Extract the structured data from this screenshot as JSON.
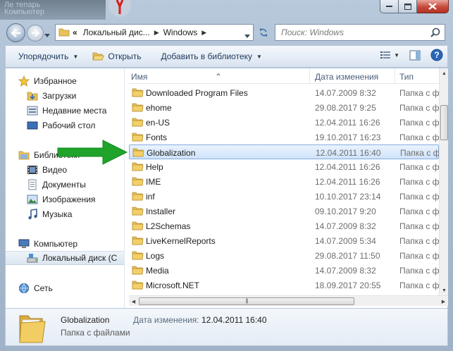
{
  "background": {
    "faint_text": "Ле тепарь\nКомпьютер"
  },
  "window": {
    "caption_buttons": [
      "minimize",
      "maximize",
      "close"
    ]
  },
  "address": {
    "crumbs": [
      "Локальный дис...",
      "Windows"
    ],
    "overflow": "«"
  },
  "search": {
    "placeholder": "Поиск: Windows"
  },
  "toolbar": {
    "organize": "Упорядочить",
    "open": "Открыть",
    "add_library": "Добавить в библиотеку"
  },
  "nav": {
    "favorites": "Избранное",
    "downloads": "Загрузки",
    "recent": "Недавние места",
    "desktop": "Рабочий стол",
    "libraries": "Библиотеки",
    "video": "Видео",
    "documents": "Документы",
    "pictures": "Изображения",
    "music": "Музыка",
    "computer": "Компьютер",
    "local_disk": "Локальный диск (С",
    "network": "Сеть"
  },
  "columns": {
    "name": "Имя",
    "date": "Дата изменения",
    "type": "Тип"
  },
  "files": [
    {
      "name": "Downloaded Program Files",
      "date": "14.07.2009 8:32",
      "type": "Папка с ф"
    },
    {
      "name": "ehome",
      "date": "29.08.2017 9:25",
      "type": "Папка с ф"
    },
    {
      "name": "en-US",
      "date": "12.04.2011 16:26",
      "type": "Папка с ф"
    },
    {
      "name": "Fonts",
      "date": "19.10.2017 16:23",
      "type": "Папка с ф"
    },
    {
      "name": "Globalization",
      "date": "12.04.2011 16:40",
      "type": "Папка с ф"
    },
    {
      "name": "Help",
      "date": "12.04.2011 16:26",
      "type": "Папка с ф"
    },
    {
      "name": "IME",
      "date": "12.04.2011 16:26",
      "type": "Папка с ф"
    },
    {
      "name": "inf",
      "date": "10.10.2017 23:14",
      "type": "Папка с ф"
    },
    {
      "name": "Installer",
      "date": "09.10.2017 9:20",
      "type": "Папка с ф"
    },
    {
      "name": "L2Schemas",
      "date": "14.07.2009 8:32",
      "type": "Папка с ф"
    },
    {
      "name": "LiveKernelReports",
      "date": "14.07.2009 5:34",
      "type": "Папка с ф"
    },
    {
      "name": "Logs",
      "date": "29.08.2017 11:50",
      "type": "Папка с ф"
    },
    {
      "name": "Media",
      "date": "14.07.2009 8:32",
      "type": "Папка с ф"
    },
    {
      "name": "Microsoft.NET",
      "date": "18.09.2017 20:55",
      "type": "Папка с ф"
    }
  ],
  "selected_index": 4,
  "details": {
    "name": "Globalization",
    "type": "Папка с файлами",
    "date_label": "Дата изменения:",
    "date_value": "12.04.2011 16:40"
  },
  "colors": {
    "accent_arrow": "#1fa32a",
    "selection_border": "#84acdd",
    "folder": "#e8c25a"
  }
}
